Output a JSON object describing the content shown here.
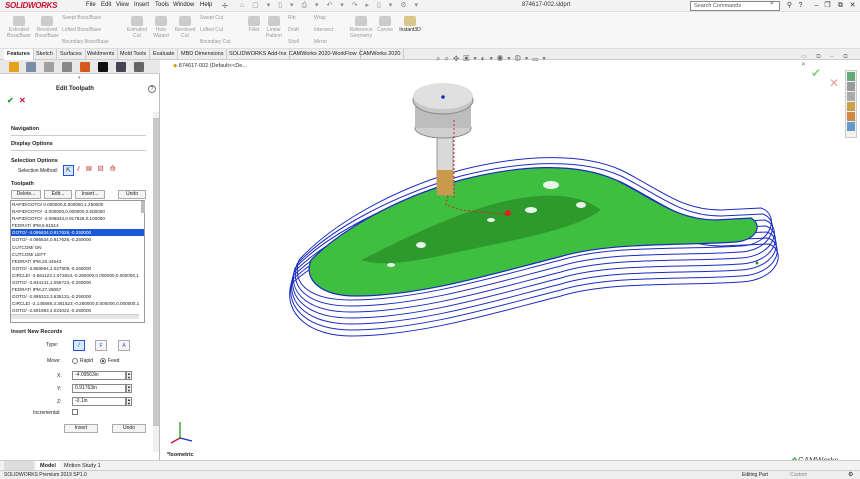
{
  "app": {
    "brand": "SOLIDWORKS",
    "filename": "874617-002.sldprt",
    "search_placeholder": "Search Commands"
  },
  "menu": [
    "File",
    "Edit",
    "View",
    "Insert",
    "Tools",
    "Window",
    "Help"
  ],
  "ribbon": [
    {
      "label": "Extruded Boss/Base"
    },
    {
      "label": "Revolved Boss/Base"
    },
    {
      "label": "Swept Boss/Base"
    },
    {
      "label": "Lofted Boss/Base"
    },
    {
      "label": "Boundary Boss/Base"
    },
    {
      "label": "Extruded Cut"
    },
    {
      "label": "Hole Wizard"
    },
    {
      "label": "Revolved Cut"
    },
    {
      "label": "Swept Cut"
    },
    {
      "label": "Lofted Cut"
    },
    {
      "label": "Boundary Cut"
    },
    {
      "label": "Fillet"
    },
    {
      "label": "Linear Pattern"
    },
    {
      "label": "Rib"
    },
    {
      "label": "Draft"
    },
    {
      "label": "Shell"
    },
    {
      "label": "Wrap"
    },
    {
      "label": "Intersect"
    },
    {
      "label": "Mirror"
    },
    {
      "label": "Reference Geometry"
    },
    {
      "label": "Curves"
    },
    {
      "label": "Instant3D"
    }
  ],
  "tabs": [
    "Features",
    "Sketch",
    "Surfaces",
    "Weldments",
    "Mold Tools",
    "Evaluate",
    "MBD Dimensions",
    "SOLIDWORKS Add-Ins",
    "CAMWorks 2020-WorkFlow",
    "CAMWorks 2020"
  ],
  "breadcrumb": "874617-002  (Default<<De...",
  "panel": {
    "title": "Edit Toolpath",
    "sections": {
      "navigation": "Navigation",
      "display": "Display Options",
      "selection": "Selection Options",
      "selection_method": "Selection Method:",
      "toolpath": "Toolpath",
      "insert": "Insert New Records"
    },
    "toolpath_buttons": [
      "Delete...",
      "Edit...",
      "Insert...",
      "Undo"
    ],
    "toolpath_rows": [
      "RAPID/GOTO/ 0.000000,0.000000,1.250000",
      "RAPID/GOTO/ -2.000000,0.000000,0.500000",
      "RAPID/GOTO/ -4.095634,0.917626,0.100000",
      "FEDRAT/ IPM,6.61514",
      "GOTO/ -4.095634,0.917626,-0.250000",
      "GOTO/ -4.095634,0.917626,-0.250000",
      "CUTCOM/ ON",
      "CUTCOM/ LEFT",
      "FEDRAT/ IPM,20.44543",
      "GOTO/ -3.858994,1.027509,-0.250000",
      "CIRCLE/ -3.881123,1.072824,-0.250000,0.000000,0.000000,1",
      "GOTO/ -3.834141,1.055723,-0.250000",
      "FEDRAT/ IPM,27.26057",
      "GOTO/ -2.895313,3.635131,-0.250000",
      "CIRCLE/ -2.145569,3.361523,-0.250000,0.000000,0.000000,1",
      "GOTO/ -2.591983,4.024022,-0.250000"
    ],
    "selected_row": 4,
    "type_label": "Type:",
    "type_options": [
      "/",
      "F",
      "A"
    ],
    "move_label": "Move:",
    "move_options": [
      "Rapid",
      "Feed"
    ],
    "move_selected": "Feed",
    "x_label": "X:",
    "x_value": "-4.09563in",
    "y_label": "Y:",
    "y_value": "0.91763in",
    "z_label": "Z:",
    "z_value": "-0.1in",
    "incremental_label": "Incremental:",
    "insert_button": "Insert",
    "undo_button": "Undo"
  },
  "viewport": {
    "view_name": "*Isometric",
    "watermark": "CAMWorks"
  },
  "bottom_tabs": [
    "Model",
    "Motion Study 1"
  ],
  "status": {
    "version": "SOLIDWORKS Premium 2019 SP1.0",
    "mode": "Editing Part",
    "units": "Custom"
  },
  "colors": {
    "accent": "#c8102e",
    "selection": "#1a58d6",
    "part": "#3fbf3f",
    "toolpath": "#1a2bbf"
  }
}
